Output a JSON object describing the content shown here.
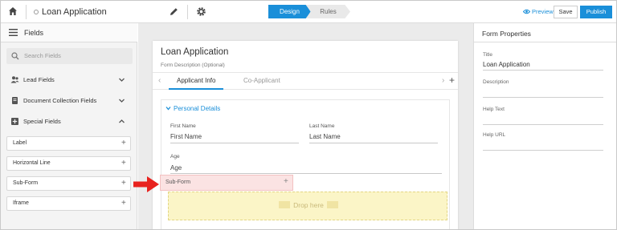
{
  "topbar": {
    "app_title": "Loan Application",
    "steps": [
      "Design",
      "Rules"
    ],
    "preview_label": "Preview",
    "save_label": "Save",
    "publish_label": "Publish",
    "accent_color": "#1a8fd9"
  },
  "left_panel": {
    "title": "Fields",
    "search_placeholder": "Search Fields",
    "categories": [
      {
        "label": "Lead Fields",
        "icon": "people-icon",
        "expanded": false
      },
      {
        "label": "Document Collection Fields",
        "icon": "document-icon",
        "expanded": false
      },
      {
        "label": "Special Fields",
        "icon": "special-fields-icon",
        "expanded": true
      }
    ],
    "special_fields": [
      "Label",
      "Horizontal Line",
      "Sub-Form",
      "Iframe"
    ]
  },
  "form": {
    "title": "Loan Application",
    "description_placeholder": "Form Description (Optional)",
    "tabs": [
      "Applicant Info",
      "Co-Applicant"
    ],
    "active_tab": "Applicant Info",
    "section_title": "Personal Details",
    "fields": [
      {
        "label": "First Name",
        "placeholder": "First Name"
      },
      {
        "label": "Last Name",
        "placeholder": "Last Name"
      },
      {
        "label": "Age",
        "placeholder": "Age"
      }
    ],
    "dragging_item": "Sub-Form",
    "drop_text": "Drop here"
  },
  "right_panel": {
    "title": "Form Properties",
    "properties": [
      {
        "label": "Title",
        "value": "Loan Application"
      },
      {
        "label": "Description",
        "value": ""
      },
      {
        "label": "Help Text",
        "value": ""
      },
      {
        "label": "Help URL",
        "value": ""
      }
    ]
  }
}
